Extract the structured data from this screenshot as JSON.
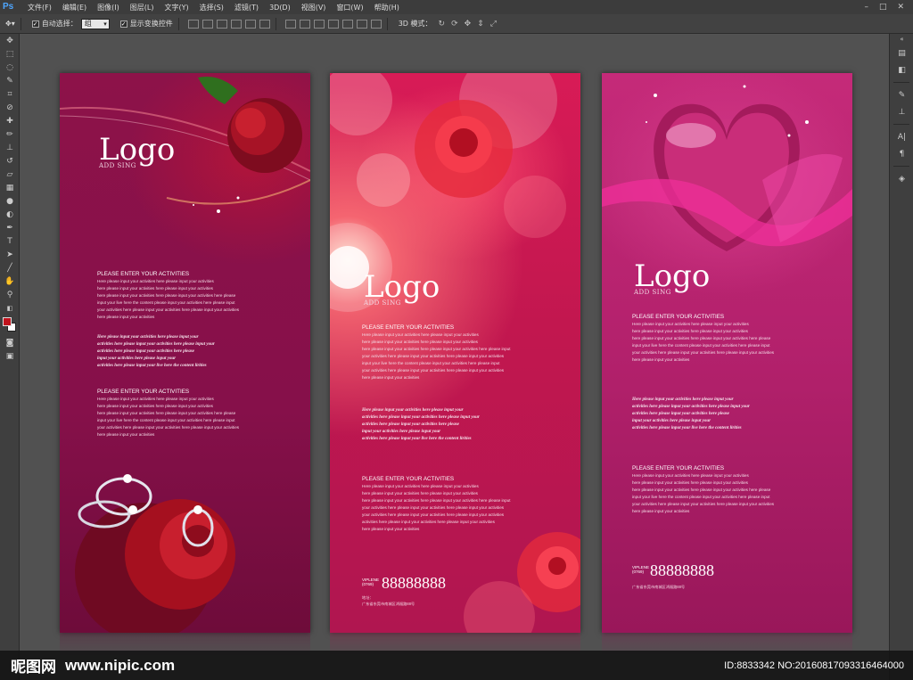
{
  "app": {
    "logo": "Ps"
  },
  "menu": [
    "文件(F)",
    "编辑(E)",
    "图像(I)",
    "图层(L)",
    "文字(Y)",
    "选择(S)",
    "滤镜(T)",
    "3D(D)",
    "视图(V)",
    "窗口(W)",
    "帮助(H)"
  ],
  "options": {
    "auto_select_label": "自动选择：",
    "auto_select_value": "组",
    "show_transform_label": "显示变换控件",
    "mode_3d_label": "3D 模式："
  },
  "panels": [
    {
      "logo": "Logo",
      "logo_sub": "ADD SING",
      "section1_title": "PLEASE ENTER YOUR ACTIVITIES",
      "section1_lines": [
        "Here please input your activities here please input your activities",
        "here please input your activities here please input your activities",
        "here please input your activities here please input your activities here please",
        "input your live here the content please input your activities here please input",
        "your activities here please input your activities here please input your activities",
        "here please input your activities"
      ],
      "italic_lines": [
        "Here please input your activities here please input your",
        "activities here please input your activities here please input your",
        "activities here please input your activities here please",
        "input your activities here please input your",
        "activities here please input your live here the content lirities"
      ],
      "section2_title": "PLEASE ENTER YOUR ACTIVITIES",
      "section2_lines": [
        "Here please input your activities here please input your activities",
        "here please input your activities here please input your activities",
        "here please input your activities here please input your activities here please",
        "input your live here the content please input your activities here please input",
        "your activities here please input your activities here please input your activities",
        "here please input your activities"
      ]
    },
    {
      "logo": "Logo",
      "logo_sub": "ADD SING",
      "section1_title": "PLEASE ENTER YOUR ACTIVITIES",
      "section1_lines": [
        "Here please input your activities here please input your activities",
        "here please input your activities here please input your activities",
        "here please input your activities here please input your activities here please input",
        "your activities here please input your activities here please input your activities",
        "input your live here the content please input your activities here please input",
        "your activities here please input your activities here please input your activities",
        "here please input your activities"
      ],
      "italic_lines": [
        "Here please input your activities here please input your",
        "activities here please input your activities here please input your",
        "activities here please input your activities here please",
        "input your activities here please input your",
        "activities here please input your live here the content lirities"
      ],
      "section2_title": "PLEASE ENTER YOUR ACTIVITIES",
      "section2_lines": [
        "Here please input your activities here please input your activities",
        "here please input your activities here please input your activities",
        "here please input your activities here please input your activities here please input",
        "your activities here please input your activities here please input your activities",
        "your activities here please input your activities here please input your activities",
        "activities here please input your activities here please input your activities",
        "here please input your activities"
      ],
      "vip_label": "VIPLENE",
      "vip_code": "(0769)",
      "phone": "88888888",
      "addr_label": "地址：",
      "addr": "广东省东莞市南城区鸿福路88号"
    },
    {
      "logo": "Logo",
      "logo_sub": "ADD SING",
      "section1_title": "PLEASE ENTER YOUR ACTIVITIES",
      "section1_lines": [
        "Here please input your activities here please input your activities",
        "here please input your activities here please input your activities",
        "here please input your activities here please input your activities here please",
        "input your live here the content please input your activities here please input",
        "your activities here please input your activities here please input your activities",
        "here please input your activities"
      ],
      "italic_lines": [
        "Here please input your activities here please input your",
        "activities here please input your activities here please input your",
        "activities here please input your activities here please",
        "input your activities here please input your",
        "activities here please input your live here the content lirities"
      ],
      "section2_title": "PLEASE ENTER YOUR ACTIVITIES",
      "section2_lines": [
        "Here please input your activities here please input your activities",
        "here please input your activities here please input your activities",
        "here please input your activities here please input your activities here please",
        "input your live here the content please input your activities here please input",
        "your activities here please input your activities here please input your activities",
        "here please input your activities"
      ],
      "vip_label": "VIPLENE",
      "vip_code": "(0769)",
      "phone": "88888888",
      "addr": "广东省东莞市南城区鸿福路88号"
    }
  ],
  "footer": {
    "logo": "昵图网",
    "url": "www.nipic.com",
    "id": "ID:8833342 NO:20160817093316464000"
  },
  "colors": {
    "foreground": "#c0131d",
    "background": "#ffffff"
  }
}
